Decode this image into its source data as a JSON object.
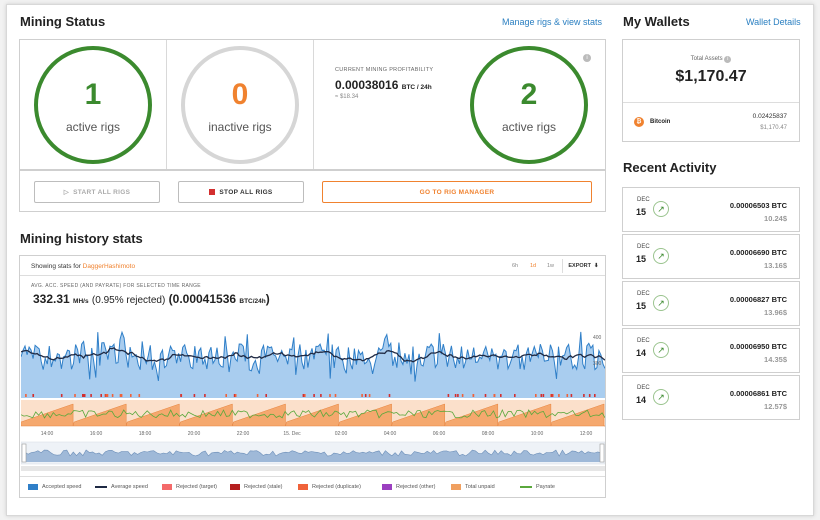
{
  "mining_status": {
    "title": "Mining Status",
    "manage_link": "Manage rigs & view stats",
    "active_rigs": {
      "count": "1",
      "label": "active rigs"
    },
    "inactive_rigs": {
      "count": "0",
      "label": "inactive rigs"
    },
    "profitability": {
      "caption": "CURRENT MINING PROFITABILITY",
      "value": "0.00038016",
      "unit": "BTC / 24h",
      "usd": "≈ $18.34"
    },
    "active_rigs_2": {
      "count": "2",
      "label": "active rigs"
    },
    "info_icon": "info-icon",
    "buttons": {
      "start": "START ALL RIGS",
      "stop": "STOP ALL RIGS",
      "manager": "GO TO RIG MANAGER"
    }
  },
  "history": {
    "title": "Mining history stats",
    "showing_prefix": "Showing stats for",
    "algorithm": "DaggerHashimoto",
    "ranges": [
      "6h",
      "1d",
      "1w"
    ],
    "export_label": "EXPORT",
    "stats_caption": "AVG. ACC. SPEED (AND PAYRATE) FOR SELECTED TIME RANGE",
    "speed": "332.31",
    "speed_unit": "MH/s",
    "rejected": "(0.95% rejected)",
    "payrate_open": "(",
    "payrate": "0.00041536",
    "payrate_unit": "BTC/24h",
    "payrate_close": ")",
    "y_labels": [
      "400",
      "300"
    ],
    "time_labels": [
      "14:00",
      "16:00",
      "18:00",
      "20:00",
      "22:00",
      "15. Dec",
      "02:00",
      "04:00",
      "06:00",
      "08:00",
      "10:00",
      "12:00"
    ],
    "legend": [
      {
        "label": "Accepted speed",
        "color": "#2f7fc8",
        "kind": "box"
      },
      {
        "label": "Average speed",
        "color": "#1f2a44",
        "kind": "line"
      },
      {
        "label": "Rejected (target)",
        "color": "#f46a6a",
        "kind": "box"
      },
      {
        "label": "Rejected (stale)",
        "color": "#b51f1f",
        "kind": "box"
      },
      {
        "label": "Rejected (duplicate)",
        "color": "#f0623a",
        "kind": "box"
      },
      {
        "label": "Rejected (other)",
        "color": "#9b3fc0",
        "kind": "box"
      },
      {
        "label": "Total unpaid",
        "color": "#f0a060",
        "kind": "box"
      },
      {
        "label": "Payrate",
        "color": "#5aa83c",
        "kind": "line"
      }
    ]
  },
  "wallets": {
    "title": "My Wallets",
    "details_link": "Wallet Details",
    "total_label": "Total Assets",
    "total_value": "$1,170.47",
    "bitcoin": {
      "name": "Bitcoin",
      "amount": "0.02425837",
      "usd": "$1,170.47"
    }
  },
  "activity": {
    "title": "Recent Activity",
    "items": [
      {
        "month": "DEC",
        "day": "15",
        "amount": "0.00006503 BTC",
        "usd": "10.24$"
      },
      {
        "month": "DEC",
        "day": "15",
        "amount": "0.00006690 BTC",
        "usd": "13.16$"
      },
      {
        "month": "DEC",
        "day": "15",
        "amount": "0.00006827 BTC",
        "usd": "13.96$"
      },
      {
        "month": "DEC",
        "day": "14",
        "amount": "0.00006950 BTC",
        "usd": "14.35$"
      },
      {
        "month": "DEC",
        "day": "14",
        "amount": "0.00006861 BTC",
        "usd": "12.57$"
      }
    ]
  },
  "colors": {
    "green": "#3b8a2e",
    "orange": "#f0822f",
    "blue": "#2f7fc8",
    "link": "#2a7fc1"
  }
}
